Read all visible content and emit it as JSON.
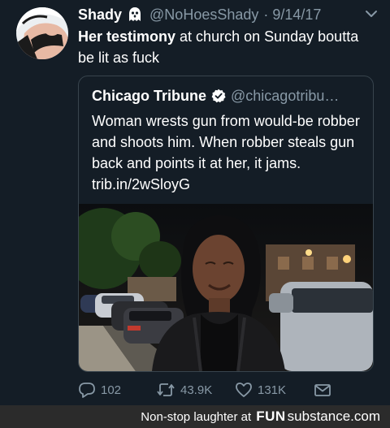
{
  "tweet": {
    "display_name": "Shady",
    "handle": "@NoHoesShady",
    "date": "· 9/14/17",
    "text_bold": "Her testimony",
    "text_rest": " at church on Sunday boutta be lit as fuck",
    "ghost_icon": "ghost-emoji",
    "menu_icon": "chevron-down-icon"
  },
  "quote": {
    "name": "Chicago Tribune",
    "handle": "@chicagotribu…",
    "text": "Woman wrests gun from would-be robber and shoots him. When robber steals gun back and points it at her, it jams. trib.in/2wSloyG",
    "verified_icon": "verified-badge-icon"
  },
  "actions": {
    "replies": "102",
    "retweets": "43.9K",
    "likes": "131K"
  },
  "footer": {
    "caption": "Non-stop laughter at",
    "logo_fun": "FUN",
    "logo_rest": "substance.com"
  },
  "colors": {
    "background": "#141d26",
    "secondary_text": "#8899a6",
    "border": "#38444d",
    "verified": "#1da1f2"
  }
}
